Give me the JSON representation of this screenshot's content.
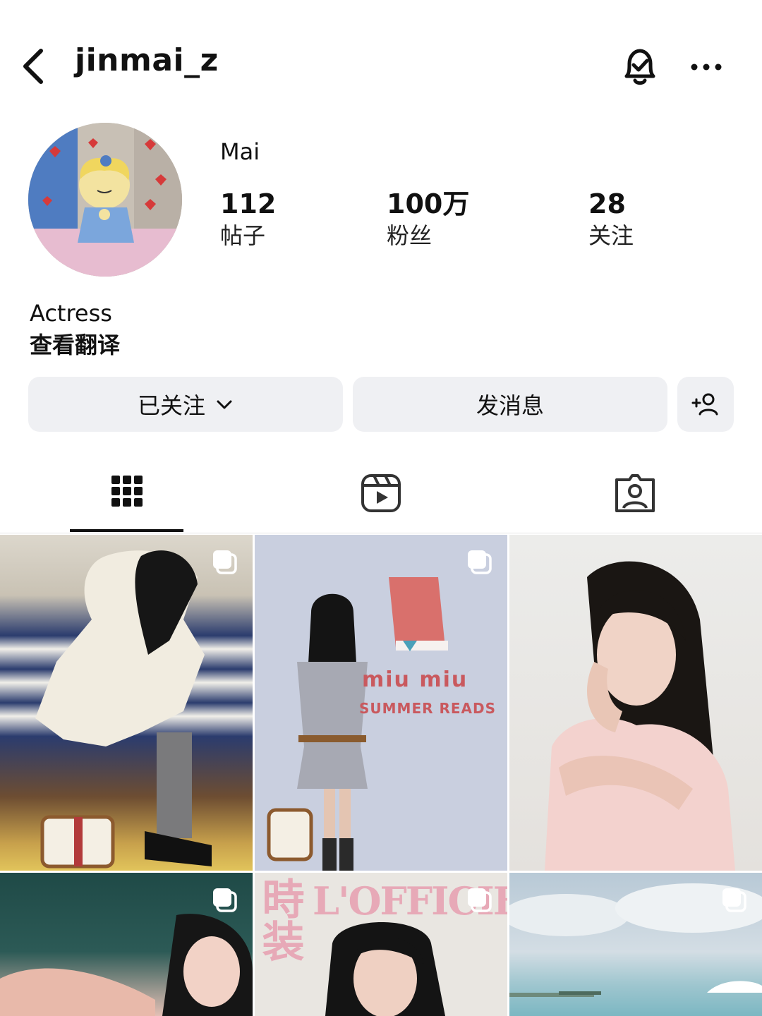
{
  "header": {
    "username": "jinmai_z"
  },
  "profile": {
    "display_name": "Mai",
    "stats": [
      {
        "value": "112",
        "label": "帖子"
      },
      {
        "value": "100万",
        "label": "粉丝"
      },
      {
        "value": "28",
        "label": "关注"
      }
    ],
    "bio": "Actress",
    "translate_link": "查看翻译"
  },
  "actions": {
    "following_label": "已关注",
    "message_label": "发消息"
  },
  "grid": {
    "posts": [
      {
        "multi": true
      },
      {
        "multi": true,
        "backdrop_brand": "miu miu",
        "backdrop_subtitle": "SUMMER READS"
      },
      {
        "multi": false
      },
      {
        "multi": true
      },
      {
        "multi": true,
        "magazine_cn": "時装",
        "magazine_en": "L'OFFICIEL"
      },
      {
        "multi": true
      }
    ]
  }
}
